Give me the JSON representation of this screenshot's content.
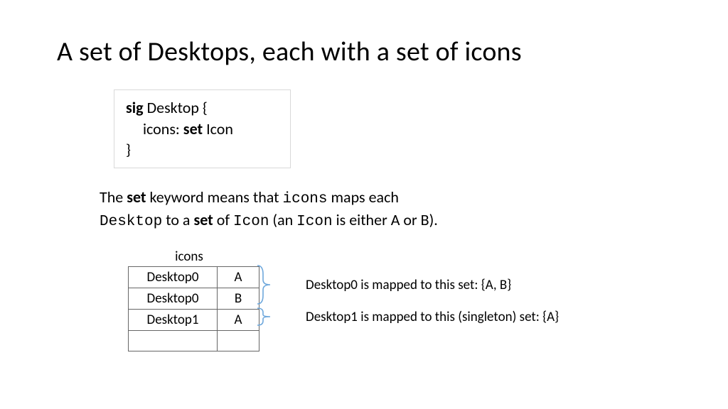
{
  "title": "A set of Desktops, each with a set of icons",
  "code": {
    "kw_sig": "sig",
    "sig_name": " Desktop {",
    "field_indent_pre": "icons: ",
    "kw_set": "set",
    "field_post": " Icon",
    "close": "}"
  },
  "explain": {
    "pre1": "The ",
    "b_set": "set",
    "pre2": " keyword means that ",
    "mono_icons": "icons",
    "pre3": " maps each ",
    "mono_desktop": "Desktop",
    "mid": " to a ",
    "b_set2": "set",
    "post1": " of ",
    "mono_icon": "Icon",
    "post2": " (an ",
    "mono_icon2": "Icon",
    "post3": " is either A or B)."
  },
  "table": {
    "caption": "icons",
    "rows": [
      {
        "c1": "Desktop0",
        "c2": "A"
      },
      {
        "c1": "Desktop0",
        "c2": "B"
      },
      {
        "c1": "Desktop1",
        "c2": "A"
      }
    ]
  },
  "annotations": {
    "a1": "Desktop0 is mapped to this set: {A, B}",
    "a2": "Desktop1 is mapped to this (singleton) set: {A}"
  }
}
